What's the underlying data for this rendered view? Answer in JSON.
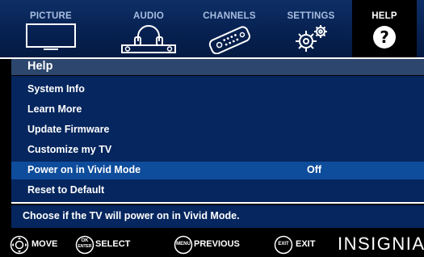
{
  "tabs": [
    {
      "label": "PICTURE",
      "icon": "picture-icon"
    },
    {
      "label": "AUDIO",
      "icon": "audio-icon"
    },
    {
      "label": "CHANNELS",
      "icon": "channels-icon"
    },
    {
      "label": "SETTINGS",
      "icon": "settings-icon"
    },
    {
      "label": "HELP",
      "icon": "help-icon",
      "active": true
    }
  ],
  "panel": {
    "title": "Help",
    "items": [
      {
        "label": "System Info",
        "value": ""
      },
      {
        "label": "Learn More",
        "value": ""
      },
      {
        "label": "Update Firmware",
        "value": ""
      },
      {
        "label": "Customize my TV",
        "value": ""
      },
      {
        "label": "Power on in Vivid Mode",
        "value": "Off",
        "selected": true
      },
      {
        "label": "Reset to Default",
        "value": ""
      }
    ],
    "description": "Choose if the TV will power on in Vivid Mode."
  },
  "footer": {
    "buttons": [
      {
        "label": "MOVE",
        "icon": "dpad-icon",
        "icon_text": ""
      },
      {
        "label": "SELECT",
        "icon": "ok-enter-icon",
        "icon_text_top": "OK",
        "icon_text_bottom": "ENTER"
      },
      {
        "label": "PREVIOUS",
        "icon": "menu-icon",
        "icon_text": "MENU"
      },
      {
        "label": "EXIT",
        "icon": "exit-icon",
        "icon_text": "EXIT"
      }
    ],
    "brand": "INSIGNIA"
  },
  "colors": {
    "tab_bar": "#06204f",
    "panel": "#05265e",
    "header": "#2c466d",
    "selected_row": "#0e4d9c",
    "tab_label": "#a7bde0"
  }
}
